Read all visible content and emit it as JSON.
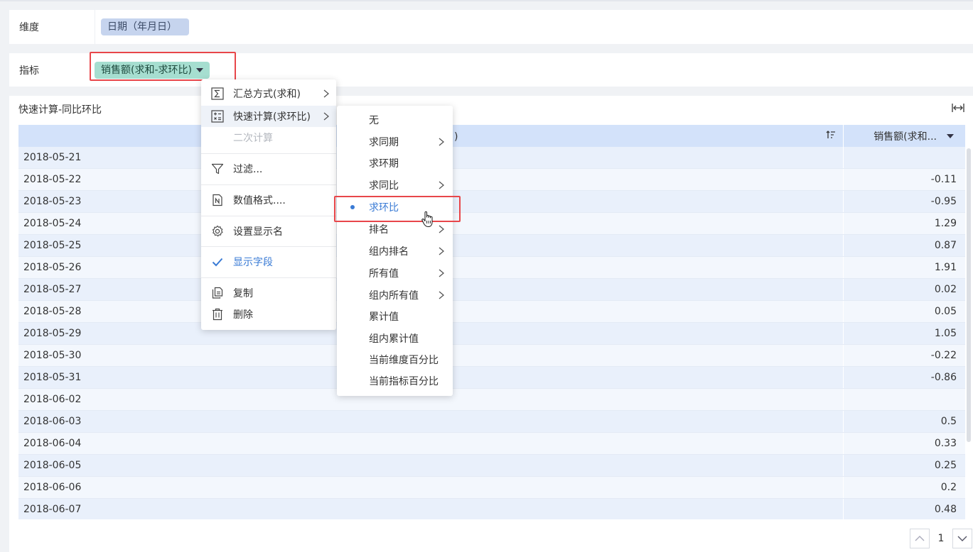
{
  "dimension": {
    "label": "维度",
    "tag": "日期（年月日）"
  },
  "indicator": {
    "label": "指标",
    "tag": "销售额(求和-求环比)"
  },
  "panel": {
    "title": "快速计算-同比环比",
    "date_header_suffix": "日)",
    "sales_header": "销售额(求和..."
  },
  "rows": [
    {
      "date": "2018-05-21",
      "value": ""
    },
    {
      "date": "2018-05-22",
      "value": "-0.11"
    },
    {
      "date": "2018-05-23",
      "value": "-0.95"
    },
    {
      "date": "2018-05-24",
      "value": "1.29"
    },
    {
      "date": "2018-05-25",
      "value": "0.87"
    },
    {
      "date": "2018-05-26",
      "value": "1.91"
    },
    {
      "date": "2018-05-27",
      "value": "0.02"
    },
    {
      "date": "2018-05-28",
      "value": "0.05"
    },
    {
      "date": "2018-05-29",
      "value": "1.05"
    },
    {
      "date": "2018-05-30",
      "value": "-0.22"
    },
    {
      "date": "2018-05-31",
      "value": "-0.86"
    },
    {
      "date": "2018-06-02",
      "value": ""
    },
    {
      "date": "2018-06-03",
      "value": "0.5"
    },
    {
      "date": "2018-06-04",
      "value": "0.33"
    },
    {
      "date": "2018-06-05",
      "value": "0.25"
    },
    {
      "date": "2018-06-06",
      "value": "0.2"
    },
    {
      "date": "2018-06-07",
      "value": "0.48"
    }
  ],
  "pager": {
    "page": "1"
  },
  "menu": {
    "summary": "汇总方式(求和)",
    "quick_calc": "快速计算(求环比)",
    "secondary_calc": "二次计算",
    "filter": "过滤...",
    "number_format": "数值格式....",
    "display_name": "设置显示名",
    "show_field": "显示字段",
    "copy": "复制",
    "delete": "删除"
  },
  "submenu": {
    "items": [
      "无",
      "求同期",
      "求环期",
      "求同比",
      "求环比",
      "排名",
      "组内排名",
      "所有值",
      "组内所有值",
      "累计值",
      "组内累计值",
      "当前维度百分比",
      "当前指标百分比"
    ]
  },
  "colors": {
    "accent": "#3a7bd5",
    "highlight": "#e8464a",
    "header": "#d3e2fa"
  }
}
